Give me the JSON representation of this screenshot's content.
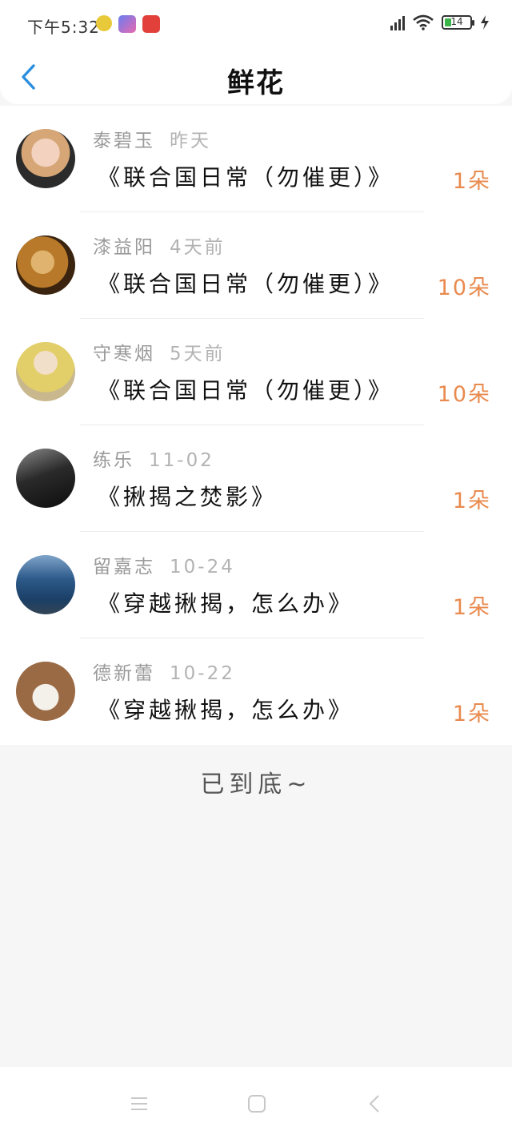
{
  "status_bar": {
    "time": "下午5:32",
    "battery_level": "14"
  },
  "header": {
    "title": "鲜花"
  },
  "gifts": [
    {
      "name": "泰碧玉",
      "date": "昨天",
      "work": "《联合国日常（勿催更）》",
      "count": "1朵"
    },
    {
      "name": "漆益阳",
      "date": "4天前",
      "work": "《联合国日常（勿催更）》",
      "count": "10朵"
    },
    {
      "name": "守寒烟",
      "date": "5天前",
      "work": "《联合国日常（勿催更）》",
      "count": "10朵"
    },
    {
      "name": "练乐",
      "date": "11-02",
      "work": "《揪揭之焚影》",
      "count": "1朵"
    },
    {
      "name": "留嘉志",
      "date": "10-24",
      "work": "《穿越揪揭，怎么办》",
      "count": "1朵"
    },
    {
      "name": "德新蕾",
      "date": "10-22",
      "work": "《穿越揪揭，怎么办》",
      "count": "1朵"
    }
  ],
  "footer": {
    "end_text": "已到底~"
  },
  "colors": {
    "accent_blue": "#2a8fe0",
    "count_orange": "#e98a4e"
  }
}
